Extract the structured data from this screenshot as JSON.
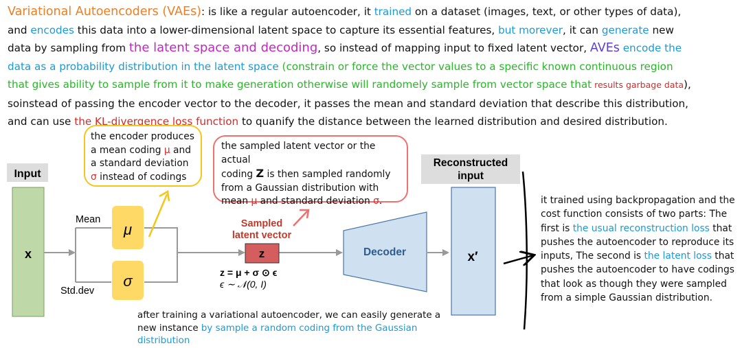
{
  "intro": {
    "l1_title": "Variational Autoencoders (VAEs)",
    "l1_a": ": is like a regular autoencoder, it ",
    "l1_trained": "trained",
    "l1_b": " on a dataset (images, text, or other types of data),",
    "l2_a": "and ",
    "l2_encodes": "encodes",
    "l2_b": " this data into a lower-dimensional latent space to capture its essential features, ",
    "l2_but": "but morever",
    "l2_c": ", it can ",
    "l2_generate": "generate",
    "l2_d": " new",
    "l3_a": "data by sampling from ",
    "l3_latent": "the latent space and decoding",
    "l3_b": ", so instead of mapping input to fixed latent vector, ",
    "l3_aves": "AVEs",
    "l3_encode": " encode the",
    "l4_prob": "data as a probability distribution in the latent space",
    "l4_a": " (",
    "l4_constrain": "constrain or force the vector values to a specific known continuous region",
    "l5_gives": "that gives  ability to sample from it to make generation otherwise will randomely sample from vector space that",
    "l5_results": " results garbage data",
    "l5_b": "),",
    "l6": "instead of passing the encoder vector to the decoder, it passes the mean and standard deviation that describe this distribution,",
    "l6_so": "so",
    "l7_a": "and can use ",
    "l7_kl": "the KL-divergence loss function",
    "l7_b": " to quanify the distance between the learned distribution and desired distribution."
  },
  "diagram": {
    "input_label": "Input",
    "x_label": "x",
    "mean_label": "Mean",
    "std_label": "Std.dev",
    "mu_symbol": "μ",
    "sigma_symbol": "σ",
    "sampled_label_1": "Sampled",
    "sampled_label_2": "latent vector",
    "z_label": "z",
    "eq1": "z = μ + σ ⊙ ϵ",
    "eq2": "ϵ ∼ 𝒩(0, I)",
    "decoder_label": "Decoder",
    "recon_label_1": "Reconstructed",
    "recon_label_2": "input",
    "xprime_label": "x′",
    "colors": {
      "input_fill": "#bed8a7",
      "mu_sigma_fill": "#ffd966",
      "z_fill": "#d45d5d",
      "decoder_fill": "#cfe0f1",
      "label_box_fill": "#dddddd",
      "sampled_text": "#c0392b"
    }
  },
  "yellow_note": {
    "l1": "the encoder produces",
    "l2a": "a mean coding ",
    "l2_mu": "μ",
    "l2b": " and",
    "l3": "a standard deviation",
    "l4_sigma": "σ",
    "l4b": " instead of codings"
  },
  "pink_note": {
    "l1": "the sampled latent vector or the actual",
    "l2a": "coding ",
    "l2_z": "Z",
    "l2b": " is then sampled randomly",
    "l3": "from a Gaussian distribution with",
    "l4a": "mean ",
    "l4_mu": "μ",
    "l4b": " and standard deviation ",
    "l4_sigma": "σ",
    "l4c": "."
  },
  "right_note": {
    "a": "it trained using backpropagation and the cost function consists of two parts: The first is ",
    "recon": "the usual reconstruction loss",
    "b": " that pushes the autoencoder to reproduce its inputs, The second is ",
    "latent": "the latent loss",
    "c": " that pushes the autoencoder to have codings that look as though they were sampled from a simple Gaussian distribution."
  },
  "bottom_note": {
    "a": "after training a variational autoencoder, we can easily generate a new instance ",
    "b": "by sample a random coding from the Gaussian distribution"
  }
}
